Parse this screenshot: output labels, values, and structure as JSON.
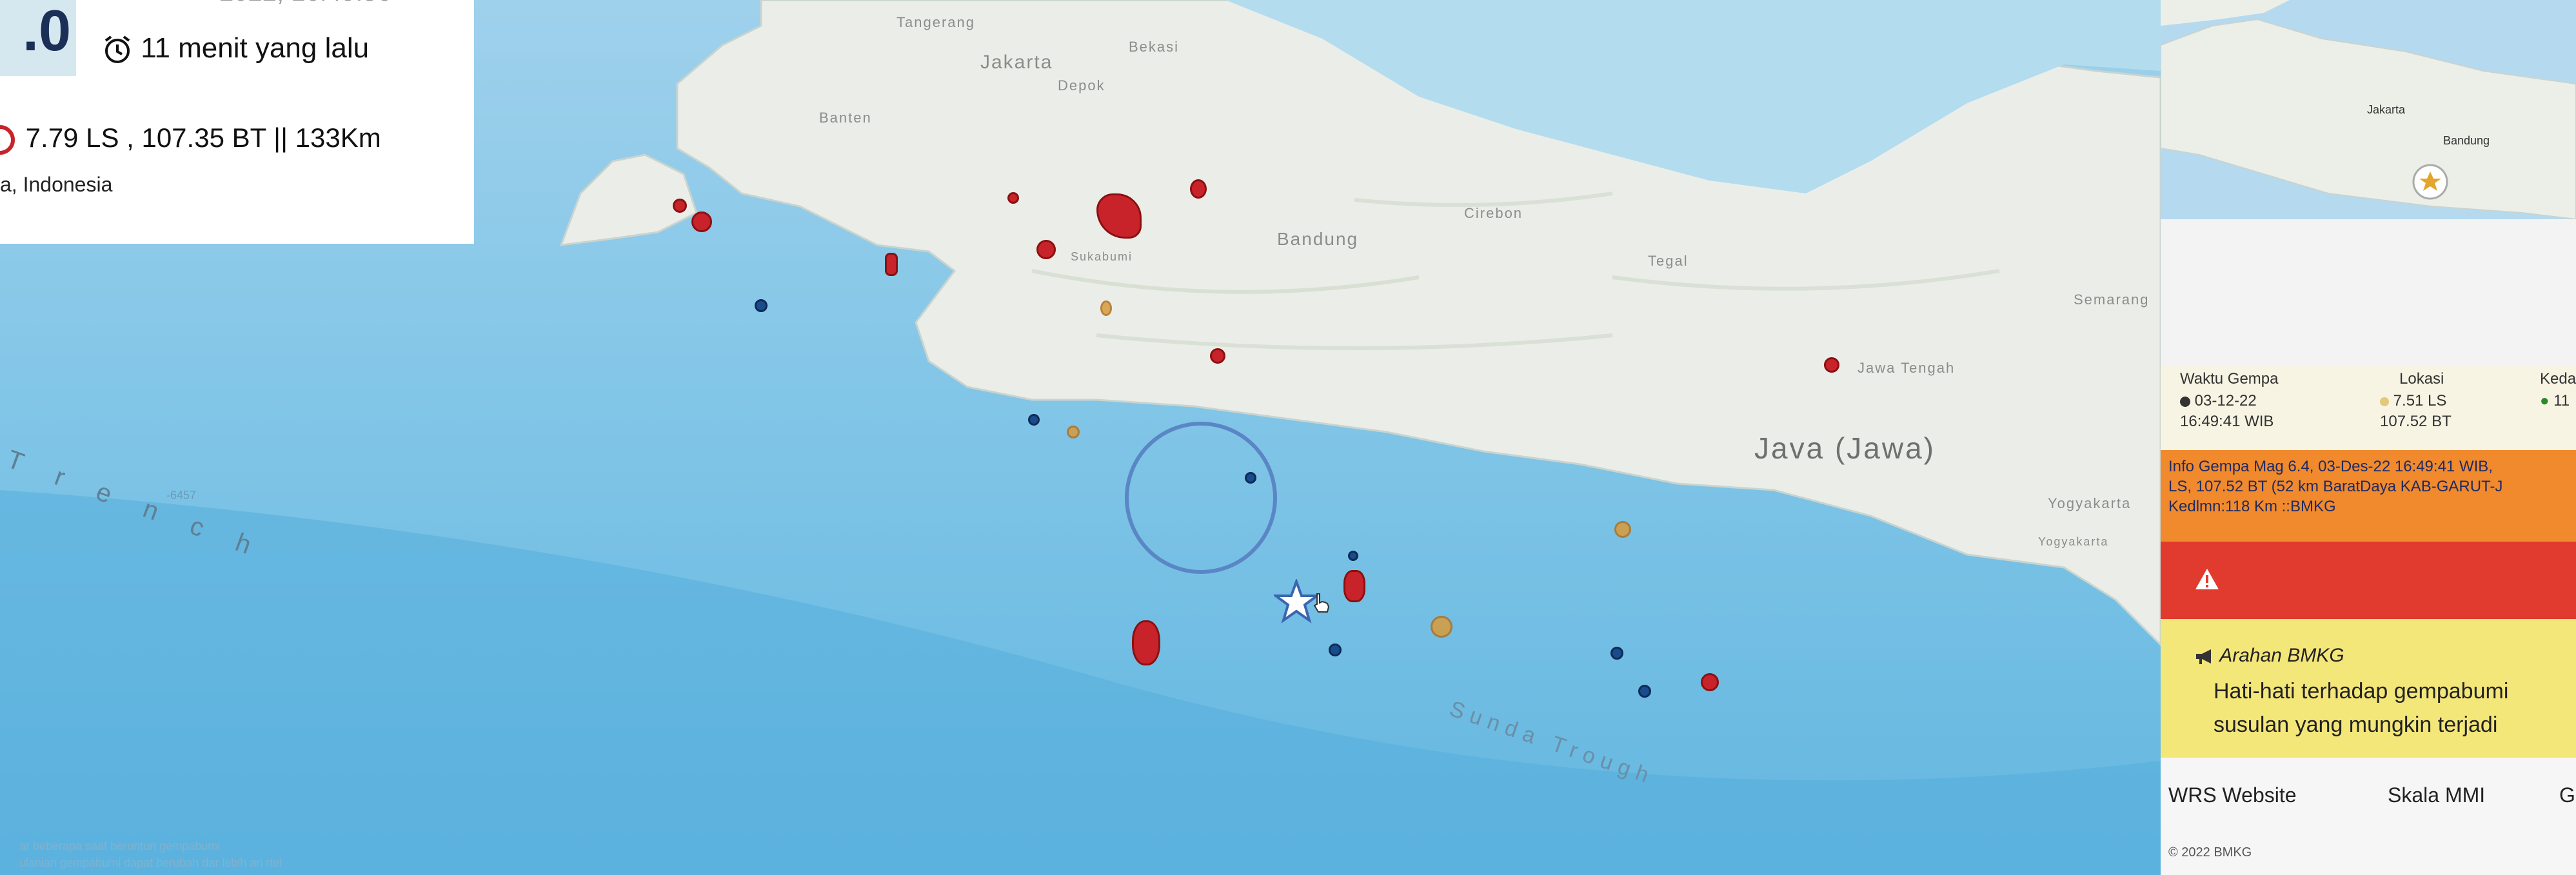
{
  "info": {
    "magnitude": ".0",
    "date_partial": "2022, 16:49:56",
    "time_ago": "11 menit yang lalu",
    "coords": "7.79 LS , 107.35 BT || 133Km",
    "region": "a, Indonesia"
  },
  "map": {
    "labels": {
      "jakarta": "Jakarta",
      "tangerang": "Tangerang",
      "bekasi": "Bekasi",
      "depok": "Depok",
      "banten": "Banten",
      "bandung": "Bandung",
      "cirebon": "Cirebon",
      "tegal": "Tegal",
      "semarang": "Semarang",
      "jawa_tengah": "Jawa Tengah",
      "java": "Java (Jawa)",
      "yogyakarta": "Yogyakarta",
      "yogyakarta_region": "Yogyakarta",
      "sukabumi": "Sukabumi",
      "sunda_trough": "Sunda Trough",
      "trench": "T r e n c h",
      "depth": "-6457"
    },
    "footnote_1": "ar beberapa saat beruntun gempabumi",
    "footnote_2": "ulanian gempabumi dapat berubah dar lebih ari rtel"
  },
  "panel": {
    "minimap": {
      "jakarta": "Jakarta",
      "bandung": "Bandung"
    },
    "table": {
      "col_waktu": "Waktu Gempa",
      "col_lokasi": "Lokasi",
      "col_kedalaman": "Keda",
      "waktu_date": "03-12-22",
      "waktu_time": "16:49:41 WIB",
      "lokasi_lat": "7.51 LS",
      "lokasi_lon": "107.52 BT",
      "kedalaman": "11"
    },
    "info_line1": "Info Gempa Mag 6.4, 03-Des-22 16:49:41 WIB,",
    "info_line2": "LS, 107.52 BT (52 km BaratDaya KAB-GARUT-J",
    "info_line3": "Kedlmn:118 Km ::BMKG",
    "arahan_title": "Arahan BMKG",
    "arahan_line1": "Hati-hati terhadap gempabumi",
    "arahan_line2": "susulan yang mungkin terjadi",
    "link_wrs": "WRS Website",
    "link_mmi": "Skala MMI",
    "link_g": "G",
    "copyright": "© 2022 BMKG"
  },
  "colors": {
    "sea": "#7cc3e6",
    "land": "#ebeee8",
    "quake_red": "#c8232b",
    "quake_blue": "#1a4b8c",
    "orange_alert": "#f08a2d",
    "red_alert": "#e13a2e",
    "arahan_yellow": "#f4e77a"
  },
  "icons": [
    "clock-icon",
    "location-icon",
    "star-epicenter-icon",
    "warning-icon",
    "megaphone-icon",
    "hand-cursor-icon"
  ]
}
